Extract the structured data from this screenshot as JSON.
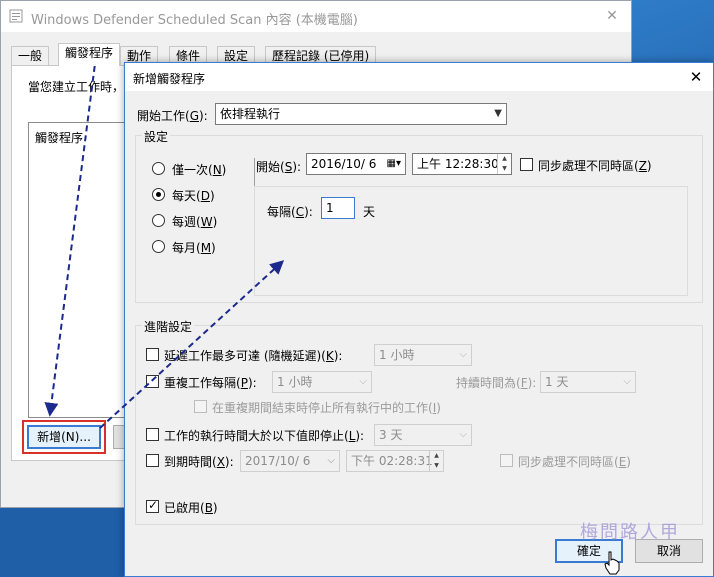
{
  "back_window": {
    "title": "Windows Defender Scheduled Scan 內容 (本機電腦)",
    "tabs": [
      "一般",
      "觸發程序",
      "動作",
      "條件",
      "設定",
      "歷程記錄 (已停用)"
    ],
    "hint": "當您建立工作時，",
    "list_header": "觸發程序",
    "new_button": "新增(N)..."
  },
  "dialog": {
    "title": "新增觸發程序",
    "start_task_label": "開始工作(",
    "start_task_key": "G",
    "start_task_value": "依排程執行",
    "settings_group": "設定",
    "radios": [
      {
        "label": "僅一次(",
        "key": "N",
        "checked": false
      },
      {
        "label": "每天(",
        "key": "D",
        "checked": true
      },
      {
        "label": "每週(",
        "key": "W",
        "checked": false
      },
      {
        "label": "每月(",
        "key": "M",
        "checked": false
      }
    ],
    "start_label": "開始(",
    "start_key": "S",
    "start_date": "2016/10/  6",
    "start_time": "上午 12:28:30",
    "sync_label": "同步處理不同時區(",
    "sync_key": "Z",
    "recur_label": "每隔(",
    "recur_key": "C",
    "recur_value": "1",
    "recur_unit": "天",
    "advanced_group": "進階設定",
    "delay": {
      "label": "延遲工作最多可達 (隨機延遲)(",
      "key": "K",
      "value": "1 小時"
    },
    "repeat": {
      "label": "重複工作每隔(",
      "key": "P",
      "value": "1 小時",
      "duration_label": "持續時間為(",
      "duration_key": "F",
      "duration_value": "1 天"
    },
    "stop_all": {
      "label": "在重複期間結束時停止所有執行中的工作(",
      "key": "I"
    },
    "stop_longer": {
      "label": "工作的執行時間大於以下值即停止(",
      "key": "L",
      "value": "3 天"
    },
    "expire": {
      "label": "到期時間(",
      "key": "X",
      "date": "2017/10/  6",
      "time": "下午 02:28:31",
      "sync_label": "同步處理不同時區(",
      "sync_key": "E"
    },
    "enabled": {
      "label": "已啟用(",
      "key": "B",
      "checked": true
    },
    "ok_button": "確定",
    "cancel_button": "取消"
  },
  "watermark": "梅問路人甲",
  "colors": {
    "accent": "#3b7ad1",
    "highlight_border": "#d9302a",
    "arrow": "#1b2a8c"
  }
}
